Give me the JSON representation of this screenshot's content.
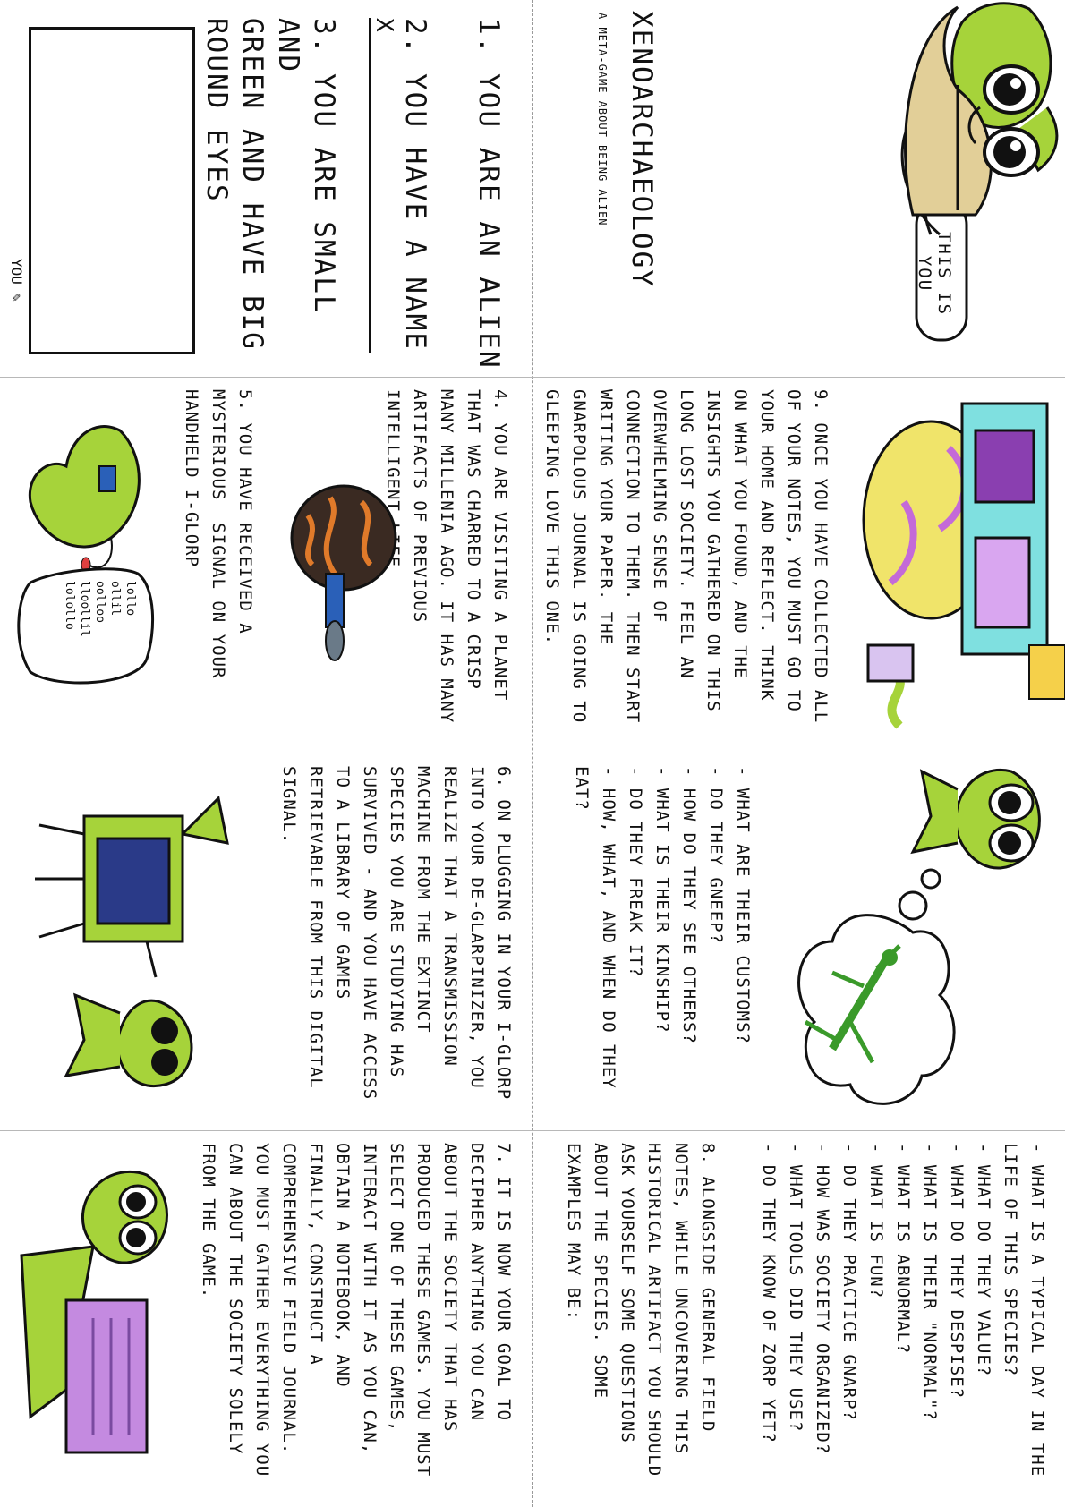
{
  "cover": {
    "title": "XENOARCHAEOLOGY",
    "subtitle": "A META-GAME ABOUT BEING ALIEN",
    "bubble": "THIS IS YOU"
  },
  "rules": {
    "r1": "1. YOU ARE AN ALIEN",
    "r2": "2. YOU HAVE A NAME",
    "name_mark": "X",
    "r3": "3. YOU ARE SMALL AND\nGREEN AND HAVE BIG\nROUND EYES",
    "portrait_label": "YOU"
  },
  "step9": "9. ONCE YOU HAVE COLLECTED ALL\nOF YOUR NOTES, YOU MUST GO TO\nYOUR HOME AND REFLECT. THINK\nON WHAT YOU FOUND, AND THE\nINSIGHTS YOU GATHERED ON THIS\nLONG LOST SOCIETY. FEEL AN\nOVERWHELMING SENSE OF\nCONNECTION TO THEM. THEN START\nWRITING YOUR PAPER. THE\nGNARPOLOUS JOURNAL IS GOING TO\nGLEEPING LOVE THIS ONE.",
  "step4": "4. YOU ARE VISITING A PLANET\nTHAT WAS CHARRED TO A CRISP\nMANY MILLENIA AGO. IT HAS MANY\nARTIFACTS OF PREVIOUS\nINTELLIGENT LIFE",
  "step5": "5. YOU HAVE RECEIVED A\nMYSTERIOUS  SIGNAL ON YOUR\nHANDHELD I-GLORP",
  "speech": "lollo\nollil\noolloo\nlloollil\nlolollo",
  "questions1": [
    "- WHAT ARE THEIR CUSTOMS?",
    "- DO THEY GNEEP?",
    "- HOW DO THEY SEE OTHERS?",
    "- WHAT IS THEIR KINSHIP?",
    "- DO THEY FREAK IT?",
    "- HOW, WHAT, AND WHEN DO THEY\nEAT?"
  ],
  "step6": "6. ON PLUGGING IN YOUR I-GLORP\nINTO YOUR DE-GLARPINIZER, YOU\nREALIZE THAT A TRANSMISSION\nMACHINE FROM THE EXTINCT\nSPECIES YOU ARE STUDYING HAS\nSURVIVED - AND YOU HAVE ACCESS\nTO A LIBRARY OF GAMES\nRETRIEVABLE FROM THIS DIGITAL\nSIGNAL.",
  "step8": "8. ALONGSIDE GENERAL FIELD\nNOTES, WHILE UNCOVERING THIS\nHISTORICAL ARTIFACT YOU SHOULD\nASK YOURSELF SOME QUESTIONS\nABOUT THE SPECIES. SOME\nEXAMPLES MAY BE:",
  "questions2": [
    "- WHAT IS A TYPICAL DAY IN THE\nLIFE OF THIS SPECIES?",
    "- WHAT DO THEY VALUE?",
    "- WHAT DO THEY DESPISE?",
    "- WHAT IS THEIR \"NORMAL\"?",
    "- WHAT IS ABNORMAL?",
    "- WHAT IS FUN?",
    "- DO THEY PRACTICE GNARP?",
    "- HOW WAS SOCIETY ORGANIZED?",
    "- WHAT TOOLS DID THEY USE?",
    "- DO THEY KNOW OF ZORP YET?"
  ],
  "step7": "7. IT IS NOW YOUR GOAL TO\nDECIPHER ANYTHING YOU CAN\nABOUT THE SOCIETY THAT HAS\nPRODUCED THESE GAMES. YOU MUST\nSELECT ONE OF THESE GAMES,\nINTERACT WITH IT AS YOU CAN,\nOBTAIN A NOTEBOOK, AND\nFINALLY, CONSTRUCT A\nCOMPREHENSIVE FIELD JOURNAL.\nYOU MUST GATHER EVERYTHING YOU\nCAN ABOUT THE SOCIETY SOLELY\nFROM THE GAME.",
  "colors": {
    "alien_green": "#a6d33a",
    "outline": "#111111",
    "hat": "#e2cf98",
    "fold_line": "#9a9a9a"
  }
}
